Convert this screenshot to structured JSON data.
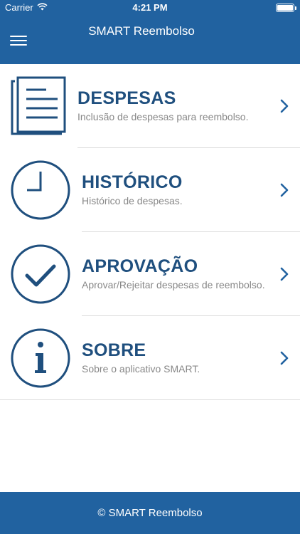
{
  "status_bar": {
    "carrier": "Carrier",
    "time": "4:21 PM"
  },
  "header": {
    "title": "SMART Reembolso",
    "menu_icon": "hamburger-menu-icon"
  },
  "menu": [
    {
      "title": "DESPESAS",
      "description": "Inclusão de despesas para reembolso.",
      "icon": "document-list-icon"
    },
    {
      "title": "HISTÓRICO",
      "description": "Histórico de despesas.",
      "icon": "clock-icon"
    },
    {
      "title": "APROVAÇÃO",
      "description": "Aprovar/Rejeitar despesas de reembolso.",
      "icon": "checkmark-circle-icon"
    },
    {
      "title": "SOBRE",
      "description": "Sobre o aplicativo SMART.",
      "icon": "info-circle-icon"
    }
  ],
  "footer": {
    "text": "© SMART Reembolso"
  },
  "colors": {
    "primary": "#2162a0",
    "title_text": "#1f4f7e",
    "description_text": "#888888",
    "divider": "#dcdcdc",
    "background": "#ffffff"
  }
}
